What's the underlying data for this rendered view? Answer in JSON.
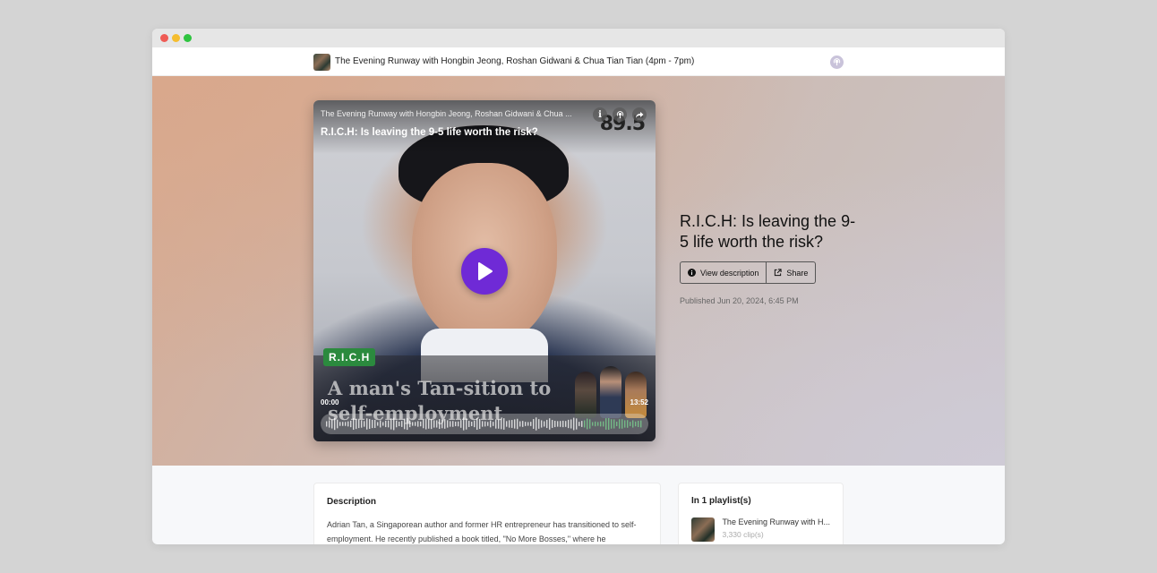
{
  "header": {
    "show_title": "The Evening Runway with Hongbin Jeong, Roshan Gidwani & Chua Tian Tian (4pm - 7pm)"
  },
  "player": {
    "show_line": "The Evening Runway with Hongbin Jeong, Roshan Gidwani & Chua ...",
    "episode_title": "R.I.C.H: Is leaving the 9-5 life worth the risk?",
    "station_logo": "89.5",
    "tag": "R.I.C.H",
    "headline": "A man's Tan-sition to self-employment",
    "time_current": "00:00",
    "time_total": "13:52",
    "progress": 0.0,
    "icons": [
      "info-icon",
      "podcast-icon",
      "share-arrow-icon",
      "play-icon"
    ]
  },
  "episode": {
    "title": "R.I.C.H: Is leaving the 9-5 life worth the risk?",
    "view_description_label": "View description",
    "share_label": "Share",
    "published": "Published Jun 20, 2024, 6:45 PM"
  },
  "description": {
    "heading": "Description",
    "text": "Adrian Tan, a Singaporean author and former HR entrepreneur has transitioned to self-employment. He recently published a book titled, \"No More Bosses,\" where he"
  },
  "playlists": {
    "heading": "In 1 playlist(s)",
    "items": [
      {
        "name": "The Evening Runway with H...",
        "count": "3,330 clip(s)"
      }
    ]
  },
  "colors": {
    "play_button": "#6f2ad6",
    "tag_green": "#2b8a3e",
    "window_bg": "#f7f8fa"
  }
}
